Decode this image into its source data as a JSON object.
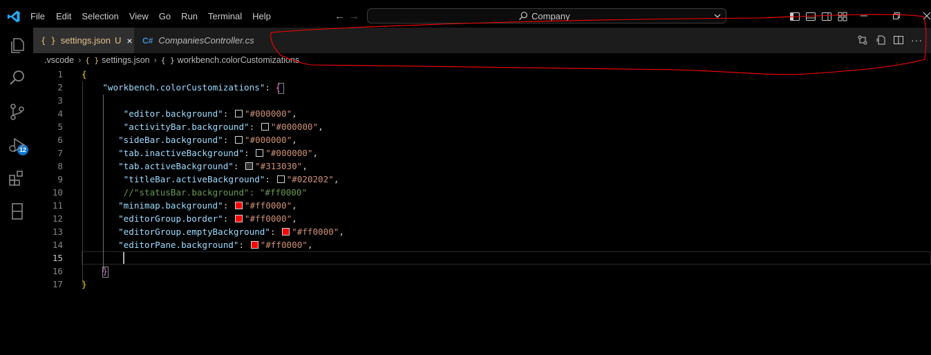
{
  "menu": [
    "File",
    "Edit",
    "Selection",
    "View",
    "Go",
    "Run",
    "Terminal",
    "Help"
  ],
  "search": {
    "text": "Company"
  },
  "tabs": [
    {
      "icon": "{ }",
      "name": "settings.json",
      "state": "U",
      "close": "×"
    },
    {
      "icon": "C#",
      "name": "CompaniesController.cs"
    }
  ],
  "tab_actions": {
    "more": "···"
  },
  "breadcrumb": [
    {
      "label": ".vscode"
    },
    {
      "icon": "{ }",
      "label": "settings.json"
    },
    {
      "icon": "{ }",
      "label": "workbench.colorCustomizations"
    }
  ],
  "activity": {
    "badge": "12"
  },
  "editor": {
    "current_line": 15,
    "lines": [
      {
        "n": "1",
        "indent": "",
        "key": "",
        "value": "",
        "open": "{",
        "comma": ""
      },
      {
        "n": "2",
        "indent": "    ",
        "key": "\"workbench.colorCustomizations\"",
        "value": "",
        "open": "{",
        "comma": ""
      },
      {
        "n": "3",
        "indent": "",
        "key": "",
        "value": "",
        "comma": ""
      },
      {
        "n": "4",
        "indent": "        ",
        "key": "\"editor.background\"",
        "swatch": "#000000",
        "value": "\"#000000\"",
        "comma": ","
      },
      {
        "n": "5",
        "indent": "        ",
        "key": "\"activityBar.background\"",
        "swatch": "#000000",
        "value": "\"#000000\"",
        "comma": ","
      },
      {
        "n": "6",
        "indent": "       ",
        "key": "\"sideBar.background\"",
        "swatch": "#000000",
        "value": "\"#000000\"",
        "comma": ","
      },
      {
        "n": "7",
        "indent": "       ",
        "key": "\"tab.inactiveBackground\"",
        "swatch": "#000000",
        "value": "\"#000000\"",
        "comma": ","
      },
      {
        "n": "8",
        "indent": "       ",
        "key": "\"tab.activeBackground\"",
        "swatch": "#313030",
        "value": "\"#313030\"",
        "comma": ","
      },
      {
        "n": "9",
        "indent": "        ",
        "key": "\"titleBar.activeBackground\"",
        "swatch": "#020202",
        "value": "\"#020202\"",
        "comma": ","
      },
      {
        "n": "10",
        "indent": "        ",
        "comment": "//\"statusBar.background\": \"#ff0000\""
      },
      {
        "n": "11",
        "indent": "       ",
        "key": "\"minimap.background\"",
        "swatch": "#ff0000",
        "value": "\"#ff0000\"",
        "comma": ","
      },
      {
        "n": "12",
        "indent": "       ",
        "key": "\"editorGroup.border\"",
        "swatch": "#ff0000",
        "value": "\"#ff0000\"",
        "comma": ","
      },
      {
        "n": "13",
        "indent": "       ",
        "key": "\"editorGroup.emptyBackground\"",
        "swatch": "#ff0000",
        "value": "\"#ff0000\"",
        "comma": ","
      },
      {
        "n": "14",
        "indent": "       ",
        "key": "\"editorPane.background\"",
        "swatch": "#ff0000",
        "value": "\"#ff0000\"",
        "comma": ","
      },
      {
        "n": "15",
        "indent": "",
        "key": "",
        "value": "",
        "comma": ""
      },
      {
        "n": "16",
        "indent": "    ",
        "close": "}",
        "comma": ""
      },
      {
        "n": "17",
        "indent": "",
        "close": "}",
        "comma": ""
      }
    ]
  },
  "colors": {
    "background": "#000000",
    "active_tab": "#313030",
    "tab_bar": "#1c1c1c",
    "annotation": "#ff0000",
    "accent": "#0a76d1"
  }
}
